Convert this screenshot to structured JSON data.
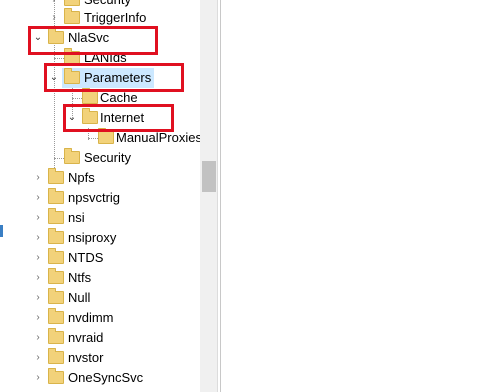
{
  "tree": {
    "items": [
      {
        "label": "Security",
        "level": 2
      },
      {
        "label": "TriggerInfo",
        "level": 2
      },
      {
        "label": "NlaSvc",
        "level": 1
      },
      {
        "label": "LANIds",
        "level": 2
      },
      {
        "label": "Parameters",
        "level": 2
      },
      {
        "label": "Cache",
        "level": 3
      },
      {
        "label": "Internet",
        "level": 3
      },
      {
        "label": "ManualProxies",
        "level": 4
      },
      {
        "label": "Security",
        "level": 2
      },
      {
        "label": "Npfs",
        "level": 1
      },
      {
        "label": "npsvctrig",
        "level": 1
      },
      {
        "label": "nsi",
        "level": 1
      },
      {
        "label": "nsiproxy",
        "level": 1
      },
      {
        "label": "NTDS",
        "level": 1
      },
      {
        "label": "Ntfs",
        "level": 1
      },
      {
        "label": "Null",
        "level": 1
      },
      {
        "label": "nvdimm",
        "level": 1
      },
      {
        "label": "nvraid",
        "level": 1
      },
      {
        "label": "nvstor",
        "level": 1
      },
      {
        "label": "OneSyncSvc",
        "level": 1
      }
    ]
  },
  "colors": {
    "highlight_box": "#e01020",
    "selection": "#cce8ff",
    "folder": "#f2d27a"
  }
}
